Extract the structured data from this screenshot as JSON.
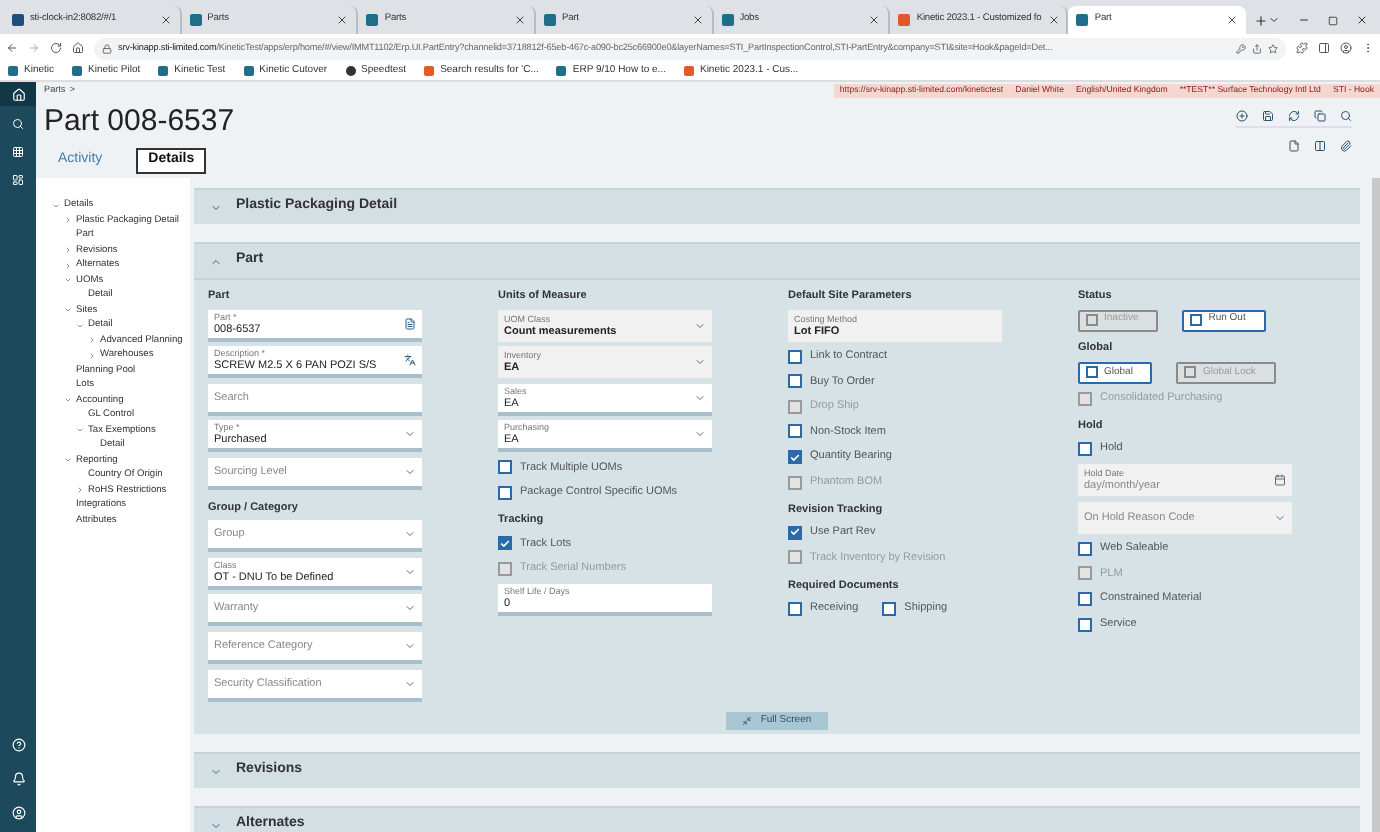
{
  "browser": {
    "tabs": [
      {
        "title": "sti-clock-in2:8082/#/1",
        "selected": false
      },
      {
        "title": "Parts",
        "selected": false
      },
      {
        "title": "Parts",
        "selected": false
      },
      {
        "title": "Part",
        "selected": false
      },
      {
        "title": "Jobs",
        "selected": false
      },
      {
        "title": "Kinetic 2023.1 - Customized fo",
        "selected": false
      },
      {
        "title": "Part",
        "selected": true
      }
    ],
    "url_host": "srv-kinapp.sti-limited.com",
    "url_path": "/KineticTest/apps/erp/home/#/view/IMMT1102/Erp.UI.PartEntry?channelid=3718812f-65eb-467c-a090-bc25c66900e0&layerNames=STI_PartInspectionControl,STI-PartEntry&company=STI&site=Hook&pageId=Det...",
    "bookmarks": [
      "Kinetic",
      "Kinetic Pilot",
      "Kinetic Test",
      "Kinetic Cutover",
      "Speedtest",
      "Search results for 'C...",
      "ERP 9/10 How to e...",
      "Kinetic 2023.1 - Cus..."
    ]
  },
  "breadcrumb": [
    "Parts",
    ">"
  ],
  "info_strip": [
    "https://srv-kinapp.sti-limited.com/kinetictest",
    "Daniel White",
    "English/United Kingdom",
    "**TEST** Surface Technology Intl Ltd",
    "STI - Hook"
  ],
  "page": {
    "title": "Part 008-6537",
    "tabs": [
      {
        "label": "Activity",
        "selected": false
      },
      {
        "label": "Details",
        "selected": true
      }
    ]
  },
  "tree": [
    {
      "label": "Details",
      "expanded": true,
      "children": [
        {
          "label": "Plastic Packaging Detail",
          "expanded": false
        },
        {
          "label": "Part"
        },
        {
          "label": "Revisions",
          "expanded": false
        },
        {
          "label": "Alternates",
          "expanded": false
        },
        {
          "label": "UOMs",
          "expanded": true,
          "children": [
            {
              "label": "Detail"
            }
          ]
        },
        {
          "label": "Sites",
          "expanded": true,
          "children": [
            {
              "label": "Detail",
              "expanded": true,
              "children": [
                {
                  "label": "Advanced Planning",
                  "expanded": false
                },
                {
                  "label": "Warehouses",
                  "expanded": false
                }
              ]
            }
          ]
        },
        {
          "label": "Planning Pool"
        },
        {
          "label": "Lots"
        },
        {
          "label": "Accounting",
          "expanded": true,
          "children": [
            {
              "label": "GL Control"
            },
            {
              "label": "Tax Exemptions",
              "expanded": true,
              "children": [
                {
                  "label": "Detail"
                }
              ]
            }
          ]
        },
        {
          "label": "Reporting",
          "expanded": true,
          "children": [
            {
              "label": "Country Of Origin"
            },
            {
              "label": "RoHS Restrictions",
              "expanded": false
            }
          ]
        },
        {
          "label": "Integrations"
        },
        {
          "label": "Attributes"
        }
      ]
    }
  ],
  "sections": [
    {
      "title": "Plastic Packaging Detail",
      "expanded": false
    },
    {
      "title": "Part",
      "expanded": true,
      "full_screen_button": "Full Screen",
      "columns": [
        [
          {
            "kind": "heading",
            "text": "Part"
          },
          {
            "kind": "doc-text",
            "label": "Part *",
            "value": "008-6537",
            "disabled": false
          },
          {
            "kind": "lang-text",
            "label": "Description *",
            "value": "SCREW M2.5 X 6 PAN POZI S/S",
            "disabled": false
          },
          {
            "kind": "search",
            "placeholder": "Search"
          },
          {
            "kind": "select",
            "label": "Type *",
            "value": "Purchased",
            "disabled": false
          },
          {
            "kind": "select",
            "placeholder": "Sourcing Level",
            "disabled": false
          },
          {
            "kind": "heading",
            "text": "Group / Category"
          },
          {
            "kind": "select",
            "placeholder": "Group",
            "disabled": false
          },
          {
            "kind": "select",
            "label": "Class",
            "value": "OT - DNU To be Defined",
            "disabled": false
          },
          {
            "kind": "select",
            "placeholder": "Warranty",
            "disabled": false
          },
          {
            "kind": "select",
            "placeholder": "Reference Category",
            "disabled": false
          },
          {
            "kind": "select",
            "placeholder": "Security Classification",
            "disabled": false
          }
        ],
        [
          {
            "kind": "heading",
            "text": "Units of Measure"
          },
          {
            "kind": "select",
            "label": "UOM Class",
            "value": "Count measurements",
            "disabled": true
          },
          {
            "kind": "select",
            "label": "Inventory",
            "value": "EA",
            "disabled": true
          },
          {
            "kind": "select",
            "label": "Sales",
            "value": "EA",
            "disabled": false
          },
          {
            "kind": "select",
            "label": "Purchasing",
            "value": "EA",
            "disabled": false
          },
          {
            "kind": "checkbox",
            "label": "Track Multiple UOMs",
            "checked": false,
            "disabled": false
          },
          {
            "kind": "checkbox",
            "label": "Package Control Specific UOMs",
            "checked": false,
            "disabled": false
          },
          {
            "kind": "heading",
            "text": "Tracking"
          },
          {
            "kind": "checkbox",
            "label": "Track Lots",
            "checked": true,
            "disabled": false
          },
          {
            "kind": "checkbox",
            "label": "Track Serial Numbers",
            "checked": false,
            "disabled": true
          },
          {
            "kind": "text",
            "label": "Shelf Life / Days",
            "value": "0",
            "disabled": false
          }
        ],
        [
          {
            "kind": "heading",
            "text": "Default Site Parameters"
          },
          {
            "kind": "text",
            "label": "Costing Method",
            "value": "Lot FIFO",
            "disabled": true
          },
          {
            "kind": "checkbox",
            "label": "Link to Contract",
            "checked": false,
            "disabled": false
          },
          {
            "kind": "checkbox",
            "label": "Buy To Order",
            "checked": false,
            "disabled": false
          },
          {
            "kind": "checkbox",
            "label": "Drop Ship",
            "checked": false,
            "disabled": true
          },
          {
            "kind": "checkbox",
            "label": "Non-Stock Item",
            "checked": false,
            "disabled": false
          },
          {
            "kind": "checkbox",
            "label": "Quantity Bearing",
            "checked": true,
            "disabled": false
          },
          {
            "kind": "checkbox",
            "label": "Phantom BOM",
            "checked": false,
            "disabled": true
          },
          {
            "kind": "heading",
            "text": "Revision Tracking"
          },
          {
            "kind": "checkbox",
            "label": "Use Part Rev",
            "checked": true,
            "disabled": false
          },
          {
            "kind": "checkbox",
            "label": "Track Inventory by Revision",
            "checked": false,
            "disabled": true
          },
          {
            "kind": "heading",
            "text": "Required Documents"
          },
          {
            "kind": "row",
            "items": [
              {
                "kind": "checkbox",
                "label": "Receiving",
                "checked": false,
                "disabled": false
              },
              {
                "kind": "checkbox",
                "label": "Shipping",
                "checked": false,
                "disabled": false
              }
            ]
          }
        ],
        [
          {
            "kind": "heading",
            "text": "Status"
          },
          {
            "kind": "row",
            "items": [
              {
                "kind": "chip",
                "label": "Inactive",
                "checked": false,
                "disabled": true
              },
              {
                "kind": "chip",
                "label": "Run Out",
                "checked": false,
                "disabled": false
              }
            ]
          },
          {
            "kind": "heading",
            "text": "Global"
          },
          {
            "kind": "row",
            "items": [
              {
                "kind": "chip",
                "label": "Global",
                "checked": false,
                "disabled": false
              },
              {
                "kind": "chip",
                "label": "Global Lock",
                "checked": false,
                "disabled": true
              }
            ]
          },
          {
            "kind": "checkbox",
            "label": "Consolidated Purchasing",
            "checked": false,
            "disabled": true
          },
          {
            "kind": "heading",
            "text": "Hold"
          },
          {
            "kind": "checkbox",
            "label": "Hold",
            "checked": false,
            "disabled": false
          },
          {
            "kind": "date",
            "label": "Hold Date",
            "placeholder": "day/month/year",
            "disabled": true
          },
          {
            "kind": "select",
            "placeholder": "On Hold Reason Code",
            "disabled": true
          },
          {
            "kind": "checkbox",
            "label": "Web Saleable",
            "checked": false,
            "disabled": false
          },
          {
            "kind": "checkbox",
            "label": "PLM",
            "checked": false,
            "disabled": true
          },
          {
            "kind": "checkbox",
            "label": "Constrained Material",
            "checked": false,
            "disabled": false
          },
          {
            "kind": "checkbox",
            "label": "Service",
            "checked": false,
            "disabled": false
          }
        ]
      ]
    },
    {
      "title": "Revisions",
      "expanded": false
    },
    {
      "title": "Alternates",
      "expanded": false
    }
  ]
}
